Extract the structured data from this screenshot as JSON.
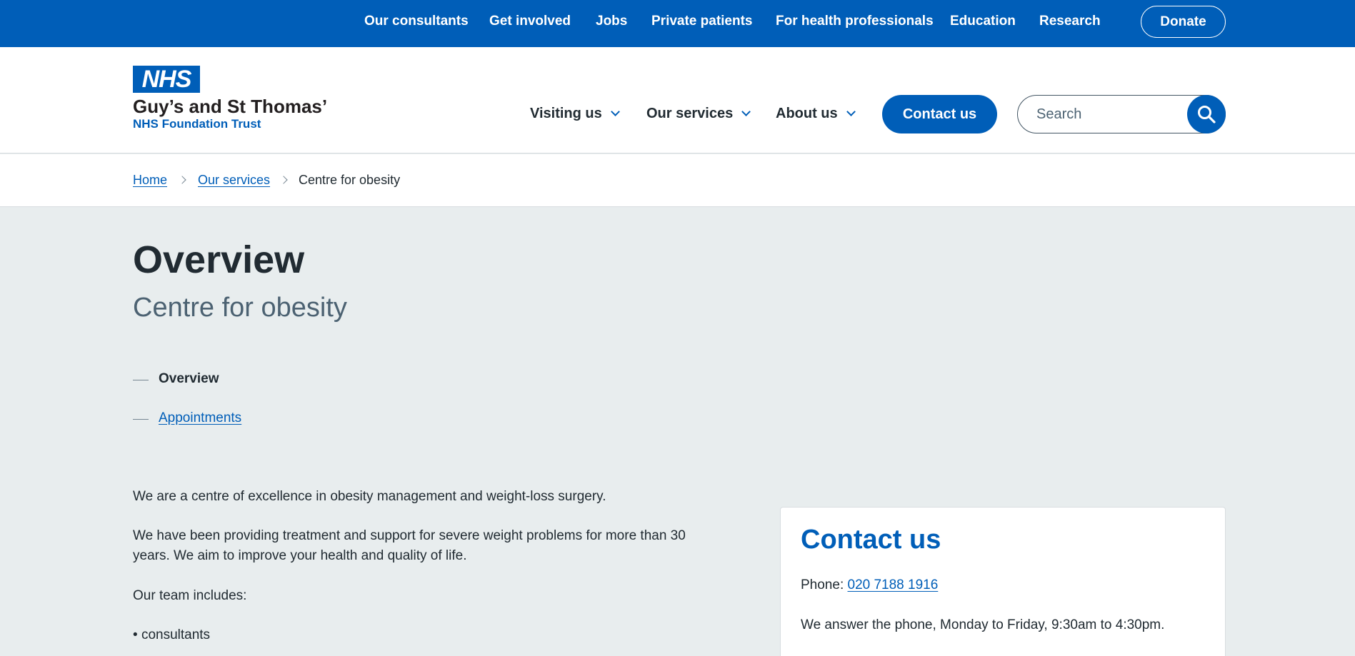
{
  "topnav": {
    "items": [
      "Our consultants",
      "Get involved",
      "Jobs",
      "Private patients",
      "For health professionals",
      "Education",
      "Research"
    ],
    "donate": "Donate"
  },
  "header": {
    "logo_text": "NHS",
    "org_name": "Guy’s and St Thomas’",
    "org_sub": "NHS Foundation Trust",
    "nav": [
      "Visiting us",
      "Our services",
      "About us"
    ],
    "contact_button": "Contact us",
    "search_placeholder": "Search"
  },
  "breadcrumb": {
    "home": "Home",
    "services": "Our services",
    "current": "Centre for obesity"
  },
  "page": {
    "title": "Overview",
    "subtitle": "Centre for obesity",
    "contents": {
      "current": "Overview",
      "appointments": "Appointments"
    },
    "intro": "We are a centre of excellence in obesity management and weight-loss surgery.",
    "history": "We have been providing treatment and support for severe weight problems for more than 30 years. We aim to improve your health and quality of life.",
    "team_intro": "Our team includes:",
    "team": [
      "consultants"
    ]
  },
  "contact_card": {
    "title": "Contact us",
    "phone_label": "Phone: ",
    "phone": "020 7188 1916",
    "hours": "We answer the phone, Monday to Friday, 9:30am to 4:30pm."
  },
  "colors": {
    "brand_blue": "#005eb8",
    "page_background": "#e8edee",
    "text": "#212b32"
  }
}
